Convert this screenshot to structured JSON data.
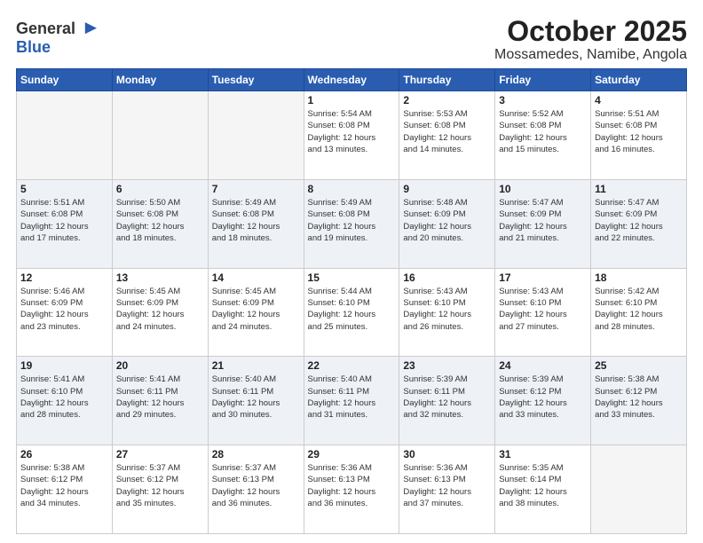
{
  "header": {
    "logo_general": "General",
    "logo_blue": "Blue",
    "month": "October 2025",
    "location": "Mossamedes, Namibe, Angola"
  },
  "weekdays": [
    "Sunday",
    "Monday",
    "Tuesday",
    "Wednesday",
    "Thursday",
    "Friday",
    "Saturday"
  ],
  "weeks": [
    [
      {
        "day": "",
        "info": ""
      },
      {
        "day": "",
        "info": ""
      },
      {
        "day": "",
        "info": ""
      },
      {
        "day": "1",
        "info": "Sunrise: 5:54 AM\nSunset: 6:08 PM\nDaylight: 12 hours\nand 13 minutes."
      },
      {
        "day": "2",
        "info": "Sunrise: 5:53 AM\nSunset: 6:08 PM\nDaylight: 12 hours\nand 14 minutes."
      },
      {
        "day": "3",
        "info": "Sunrise: 5:52 AM\nSunset: 6:08 PM\nDaylight: 12 hours\nand 15 minutes."
      },
      {
        "day": "4",
        "info": "Sunrise: 5:51 AM\nSunset: 6:08 PM\nDaylight: 12 hours\nand 16 minutes."
      }
    ],
    [
      {
        "day": "5",
        "info": "Sunrise: 5:51 AM\nSunset: 6:08 PM\nDaylight: 12 hours\nand 17 minutes."
      },
      {
        "day": "6",
        "info": "Sunrise: 5:50 AM\nSunset: 6:08 PM\nDaylight: 12 hours\nand 18 minutes."
      },
      {
        "day": "7",
        "info": "Sunrise: 5:49 AM\nSunset: 6:08 PM\nDaylight: 12 hours\nand 18 minutes."
      },
      {
        "day": "8",
        "info": "Sunrise: 5:49 AM\nSunset: 6:08 PM\nDaylight: 12 hours\nand 19 minutes."
      },
      {
        "day": "9",
        "info": "Sunrise: 5:48 AM\nSunset: 6:09 PM\nDaylight: 12 hours\nand 20 minutes."
      },
      {
        "day": "10",
        "info": "Sunrise: 5:47 AM\nSunset: 6:09 PM\nDaylight: 12 hours\nand 21 minutes."
      },
      {
        "day": "11",
        "info": "Sunrise: 5:47 AM\nSunset: 6:09 PM\nDaylight: 12 hours\nand 22 minutes."
      }
    ],
    [
      {
        "day": "12",
        "info": "Sunrise: 5:46 AM\nSunset: 6:09 PM\nDaylight: 12 hours\nand 23 minutes."
      },
      {
        "day": "13",
        "info": "Sunrise: 5:45 AM\nSunset: 6:09 PM\nDaylight: 12 hours\nand 24 minutes."
      },
      {
        "day": "14",
        "info": "Sunrise: 5:45 AM\nSunset: 6:09 PM\nDaylight: 12 hours\nand 24 minutes."
      },
      {
        "day": "15",
        "info": "Sunrise: 5:44 AM\nSunset: 6:10 PM\nDaylight: 12 hours\nand 25 minutes."
      },
      {
        "day": "16",
        "info": "Sunrise: 5:43 AM\nSunset: 6:10 PM\nDaylight: 12 hours\nand 26 minutes."
      },
      {
        "day": "17",
        "info": "Sunrise: 5:43 AM\nSunset: 6:10 PM\nDaylight: 12 hours\nand 27 minutes."
      },
      {
        "day": "18",
        "info": "Sunrise: 5:42 AM\nSunset: 6:10 PM\nDaylight: 12 hours\nand 28 minutes."
      }
    ],
    [
      {
        "day": "19",
        "info": "Sunrise: 5:41 AM\nSunset: 6:10 PM\nDaylight: 12 hours\nand 28 minutes."
      },
      {
        "day": "20",
        "info": "Sunrise: 5:41 AM\nSunset: 6:11 PM\nDaylight: 12 hours\nand 29 minutes."
      },
      {
        "day": "21",
        "info": "Sunrise: 5:40 AM\nSunset: 6:11 PM\nDaylight: 12 hours\nand 30 minutes."
      },
      {
        "day": "22",
        "info": "Sunrise: 5:40 AM\nSunset: 6:11 PM\nDaylight: 12 hours\nand 31 minutes."
      },
      {
        "day": "23",
        "info": "Sunrise: 5:39 AM\nSunset: 6:11 PM\nDaylight: 12 hours\nand 32 minutes."
      },
      {
        "day": "24",
        "info": "Sunrise: 5:39 AM\nSunset: 6:12 PM\nDaylight: 12 hours\nand 33 minutes."
      },
      {
        "day": "25",
        "info": "Sunrise: 5:38 AM\nSunset: 6:12 PM\nDaylight: 12 hours\nand 33 minutes."
      }
    ],
    [
      {
        "day": "26",
        "info": "Sunrise: 5:38 AM\nSunset: 6:12 PM\nDaylight: 12 hours\nand 34 minutes."
      },
      {
        "day": "27",
        "info": "Sunrise: 5:37 AM\nSunset: 6:12 PM\nDaylight: 12 hours\nand 35 minutes."
      },
      {
        "day": "28",
        "info": "Sunrise: 5:37 AM\nSunset: 6:13 PM\nDaylight: 12 hours\nand 36 minutes."
      },
      {
        "day": "29",
        "info": "Sunrise: 5:36 AM\nSunset: 6:13 PM\nDaylight: 12 hours\nand 36 minutes."
      },
      {
        "day": "30",
        "info": "Sunrise: 5:36 AM\nSunset: 6:13 PM\nDaylight: 12 hours\nand 37 minutes."
      },
      {
        "day": "31",
        "info": "Sunrise: 5:35 AM\nSunset: 6:14 PM\nDaylight: 12 hours\nand 38 minutes."
      },
      {
        "day": "",
        "info": ""
      }
    ]
  ]
}
